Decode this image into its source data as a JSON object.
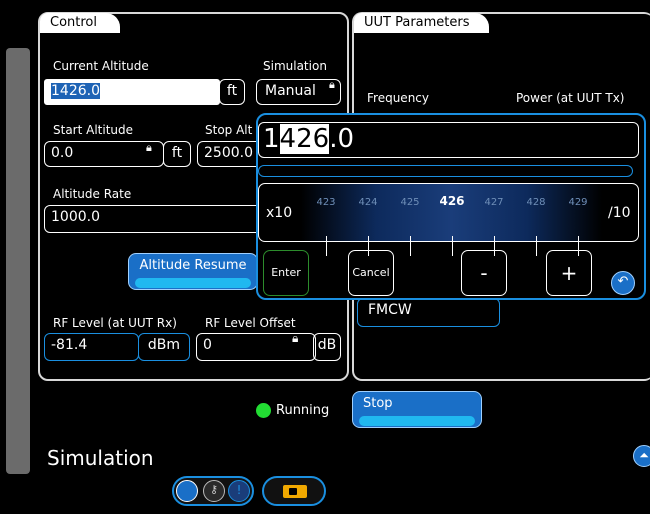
{
  "control": {
    "tab_label": "Control",
    "current_altitude_label": "Current Altitude",
    "current_altitude_value": "1426.0",
    "current_altitude_unit": "ft",
    "simulation_label": "Simulation",
    "simulation_value": "Manual",
    "start_altitude_label": "Start Altitude",
    "start_altitude_value": "0.0",
    "start_altitude_unit": "ft",
    "stop_altitude_label": "Stop Alt",
    "stop_altitude_value": "2500.0",
    "altitude_rate_label": "Altitude Rate",
    "altitude_rate_value": "1000.0",
    "altitude_resume_button": "Altitude Resume",
    "rf_level_label": "RF Level (at UUT Rx)",
    "rf_level_value": "-81.4",
    "rf_level_unit": "dBm",
    "rf_offset_label": "RF Level Offset",
    "rf_offset_value": "0",
    "rf_offset_unit": "dB"
  },
  "uut": {
    "tab_label": "UUT Parameters",
    "frequency_label": "Frequency",
    "power_label": "Power (at UUT Tx)",
    "modulation_value": "FMCW"
  },
  "keypad": {
    "value_hi": "1",
    "value_sel": "426",
    "value_lo": ".0",
    "multiplier_left": "x10",
    "multiplier_right": "/10",
    "ticks": [
      "423",
      "424",
      "425",
      "426",
      "427",
      "428",
      "429"
    ],
    "enter_label": "Enter",
    "cancel_label": "Cancel",
    "minus_label": "-",
    "plus_label": "+"
  },
  "status": {
    "running_label": "Running",
    "stop_button": "Stop"
  },
  "footer": {
    "title": "Simulation"
  },
  "colors": {
    "accent": "#1a8fe0",
    "button": "#1a6fc7",
    "running": "#22dd33"
  }
}
